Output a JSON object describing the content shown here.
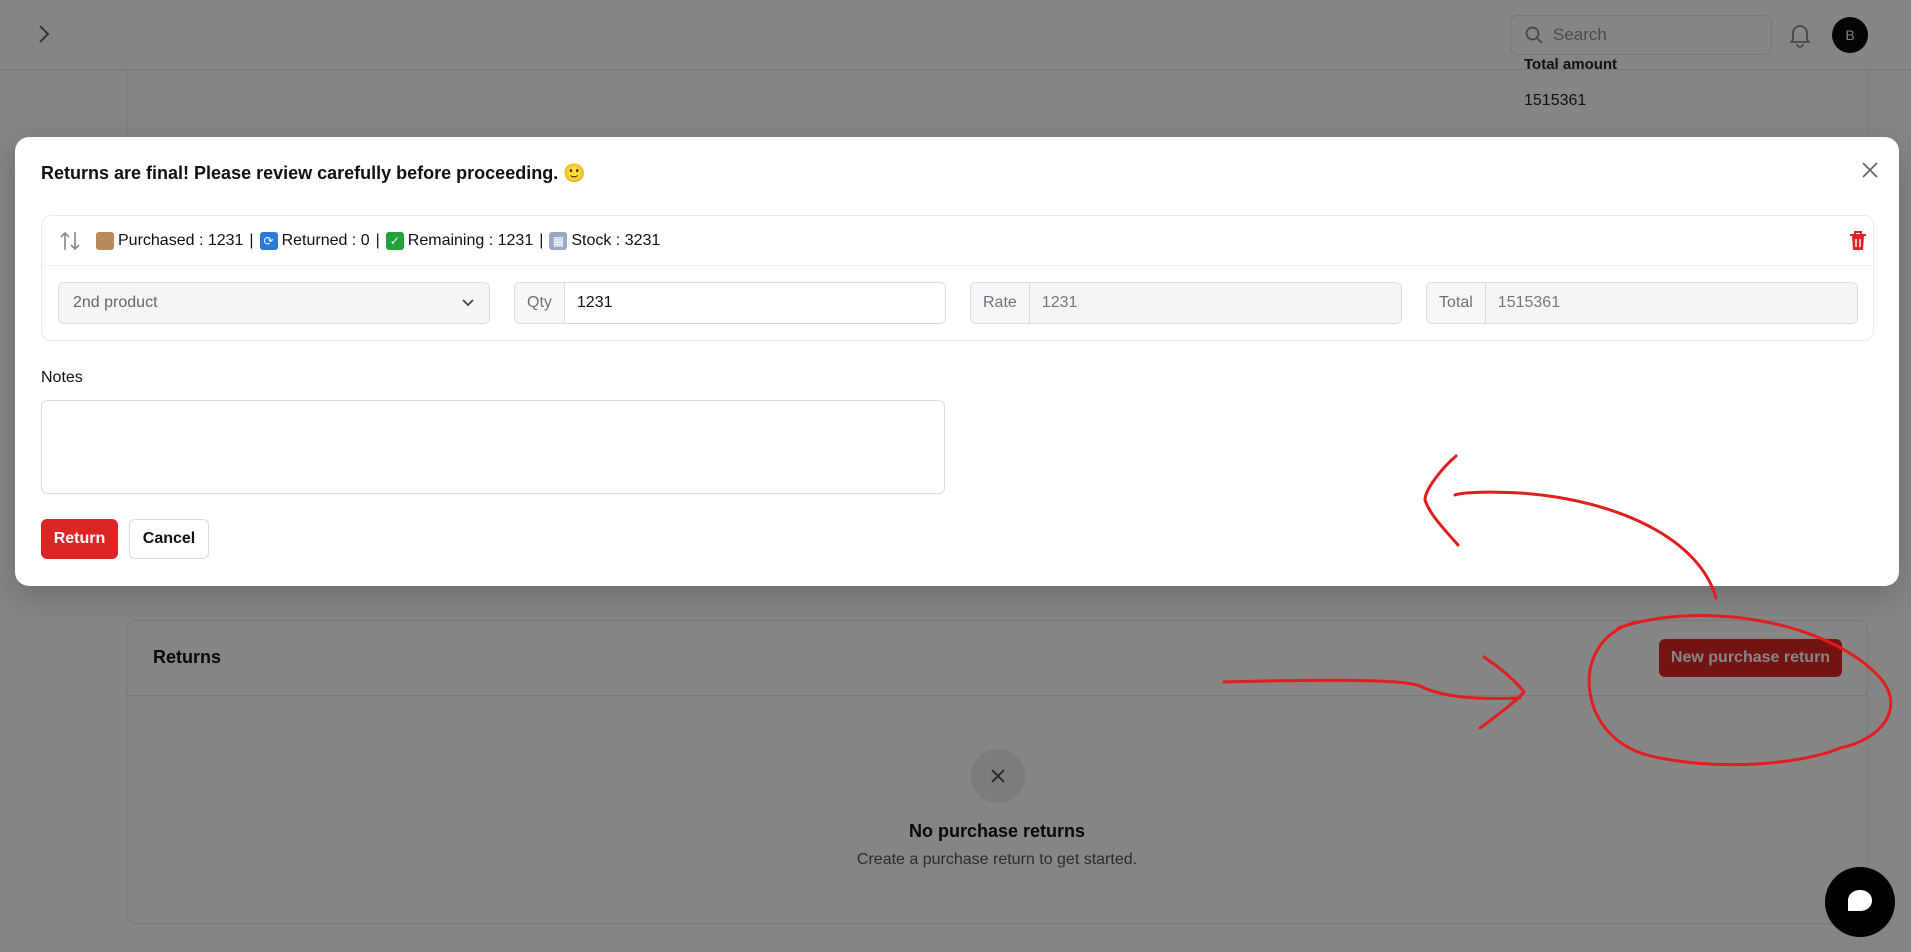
{
  "header": {
    "search_placeholder": "Search",
    "avatar_initial": "B"
  },
  "summary": {
    "total_amount_label": "Total amount",
    "total_amount_value": "1515361"
  },
  "returns_section": {
    "title": "Returns",
    "new_button_label": "New purchase return",
    "empty_title": "No purchase returns",
    "empty_subtitle": "Create a purchase return to get started."
  },
  "modal": {
    "title": "Returns are final! Please review carefully before proceeding. 🙂",
    "item": {
      "purchased_label": "Purchased : 1231",
      "returned_label": "Returned : 0",
      "remaining_label": "Remaining : 1231",
      "stock_label": "Stock : 3231",
      "separator": "|",
      "product": "2nd product",
      "qty_label": "Qty",
      "qty_value": "1231",
      "rate_label": "Rate",
      "rate_value": "1231",
      "total_label": "Total",
      "total_value": "1515361"
    },
    "notes_label": "Notes",
    "notes_value": "",
    "return_button": "Return",
    "cancel_button": "Cancel"
  },
  "colors": {
    "accent_red": "#dc2626",
    "overlay": "rgba(0,0,0,0.48)",
    "annotation_red": "#e11d1d"
  },
  "icons": {
    "sidebar_toggle": "chevron-right-icon",
    "search": "search-icon",
    "notifications": "bell-icon",
    "sidebar_nav": "cart-icon",
    "reorder": "arrows-updown-icon",
    "purchased": "box-icon",
    "returned": "cycle-icon",
    "remaining": "check-mark-icon",
    "stock": "warehouse-icon",
    "delete": "trash-icon",
    "close": "close-icon",
    "empty_state": "x-icon",
    "chat": "chat-bubble-icon"
  }
}
